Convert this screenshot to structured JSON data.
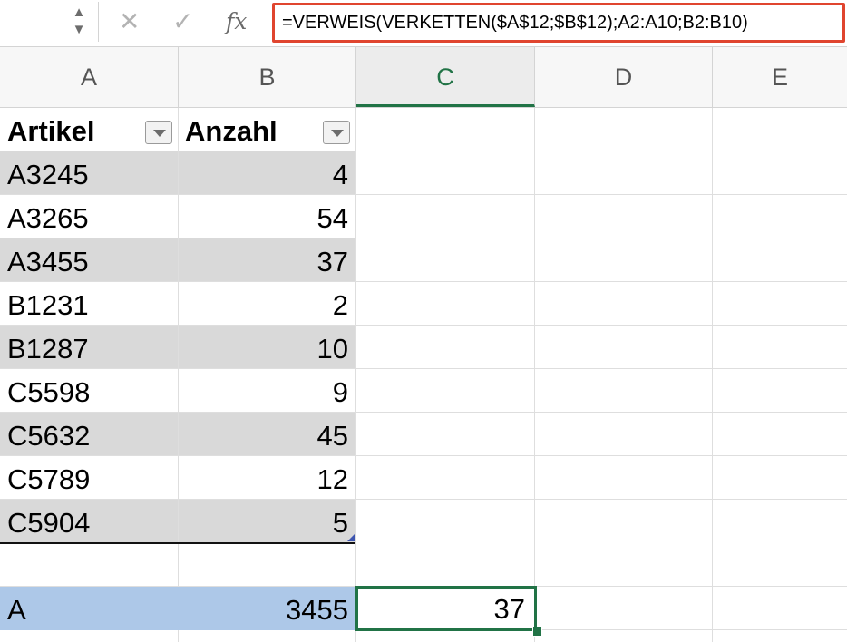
{
  "formula_bar": {
    "stepper_up": "▲",
    "stepper_down": "▼",
    "cancel_icon": "✕",
    "confirm_icon": "✓",
    "fx_label": "fx",
    "formula": "=VERWEIS(VERKETTEN($A$12;$B$12);A2:A10;B2:B10)",
    "highlight_color": "#e0452f"
  },
  "columns": [
    "A",
    "B",
    "C",
    "D",
    "E"
  ],
  "active_column": "C",
  "table": {
    "headers": [
      "Artikel",
      "Anzahl"
    ],
    "rows": [
      {
        "artikel": "A3245",
        "anzahl": "4"
      },
      {
        "artikel": "A3265",
        "anzahl": "54"
      },
      {
        "artikel": "A3455",
        "anzahl": "37"
      },
      {
        "artikel": "B1231",
        "anzahl": "2"
      },
      {
        "artikel": "B1287",
        "anzahl": "10"
      },
      {
        "artikel": "C5598",
        "anzahl": "9"
      },
      {
        "artikel": "C5632",
        "anzahl": "45"
      },
      {
        "artikel": "C5789",
        "anzahl": "12"
      },
      {
        "artikel": "C5904",
        "anzahl": "5"
      }
    ]
  },
  "lookup": {
    "a12": "A",
    "b12": "3455",
    "c12": "37"
  },
  "colors": {
    "accent": "#217346",
    "band": "#d9d9d9",
    "selection": "#adc8e8"
  }
}
